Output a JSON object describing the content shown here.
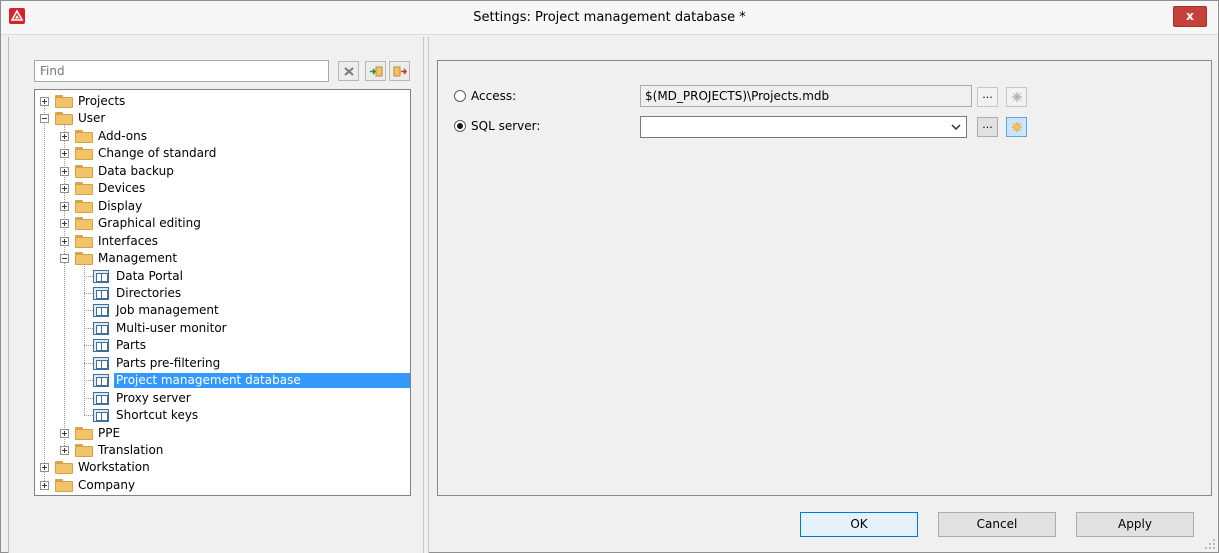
{
  "window": {
    "title": "Settings: Project management database *",
    "close_label": "x"
  },
  "search": {
    "placeholder": "Find",
    "value": ""
  },
  "tree": {
    "nodes": [
      {
        "label": "Projects",
        "level": 0,
        "expanded": false,
        "kind": "folder"
      },
      {
        "label": "User",
        "level": 0,
        "expanded": true,
        "kind": "folder"
      },
      {
        "label": "Add-ons",
        "level": 1,
        "expanded": false,
        "kind": "folder"
      },
      {
        "label": "Change of standard",
        "level": 1,
        "expanded": false,
        "kind": "folder"
      },
      {
        "label": "Data backup",
        "level": 1,
        "expanded": false,
        "kind": "folder"
      },
      {
        "label": "Devices",
        "level": 1,
        "expanded": false,
        "kind": "folder"
      },
      {
        "label": "Display",
        "level": 1,
        "expanded": false,
        "kind": "folder"
      },
      {
        "label": "Graphical editing",
        "level": 1,
        "expanded": false,
        "kind": "folder"
      },
      {
        "label": "Interfaces",
        "level": 1,
        "expanded": false,
        "kind": "folder"
      },
      {
        "label": "Management",
        "level": 1,
        "expanded": true,
        "kind": "folder"
      },
      {
        "label": "Data Portal",
        "level": 2,
        "kind": "page"
      },
      {
        "label": "Directories",
        "level": 2,
        "kind": "page"
      },
      {
        "label": "Job management",
        "level": 2,
        "kind": "page"
      },
      {
        "label": "Multi-user monitor",
        "level": 2,
        "kind": "page"
      },
      {
        "label": "Parts",
        "level": 2,
        "kind": "page"
      },
      {
        "label": "Parts pre-filtering",
        "level": 2,
        "kind": "page"
      },
      {
        "label": "Project management database",
        "level": 2,
        "kind": "page",
        "selected": true
      },
      {
        "label": "Proxy server",
        "level": 2,
        "kind": "page"
      },
      {
        "label": "Shortcut keys",
        "level": 2,
        "kind": "page"
      },
      {
        "label": "PPE",
        "level": 1,
        "expanded": false,
        "kind": "folder"
      },
      {
        "label": "Translation",
        "level": 1,
        "expanded": false,
        "kind": "folder"
      },
      {
        "label": "Workstation",
        "level": 0,
        "expanded": false,
        "kind": "folder"
      },
      {
        "label": "Company",
        "level": 0,
        "expanded": false,
        "kind": "folder"
      }
    ]
  },
  "settings": {
    "access_label": "Access:",
    "access_selected": false,
    "access_path": "$(MD_PROJECTS)\\Projects.mdb",
    "sql_label": "SQL server:",
    "sql_selected": true,
    "sql_value": "",
    "browse_label": "..."
  },
  "buttons": {
    "ok": "OK",
    "cancel": "Cancel",
    "apply": "Apply"
  },
  "colors": {
    "selection": "#3399ff",
    "close_button": "#c5423a",
    "app_icon": "#d8222a"
  }
}
